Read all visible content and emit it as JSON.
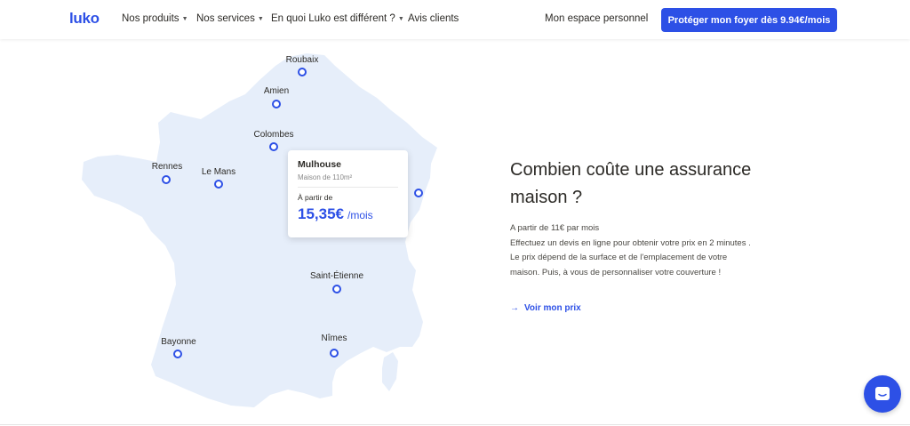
{
  "navbar": {
    "logo": "luko",
    "items": [
      {
        "label": "Nos produits",
        "dropdown": true
      },
      {
        "label": "Nos services",
        "dropdown": true
      },
      {
        "label": "En quoi Luko est différent ?",
        "dropdown": true
      },
      {
        "label": "Avis clients",
        "dropdown": false
      }
    ],
    "espace": "Mon espace personnel",
    "cta": "Protéger mon foyer dès 9.94€/mois",
    "caret": "▼"
  },
  "map": {
    "cities": [
      "Roubaix",
      "Amien",
      "Colombes",
      "Rennes",
      "Le Mans",
      "Saint-Étienne",
      "Bayonne",
      "Nîmes"
    ],
    "tooltip": {
      "city": "Mulhouse",
      "subtitle": "Maison de 110m²",
      "from": "À partir de",
      "amount": "15,35€",
      "unit": "/mois"
    }
  },
  "content": {
    "heading_line1": "Combien coûte une assurance",
    "heading_line2": "maison ?",
    "desc": [
      "A partir de 11€ par mois",
      "Effectuez un devis en ligne pour obtenir votre prix en 2 minutes .",
      "Le prix dépend de la surface et de l'emplacement de votre",
      "maison. Puis, à vous de personnaliser votre couverture !"
    ],
    "link": "Voir mon prix",
    "link_arrow": "→"
  },
  "colors": {
    "accent": "#2d50e6",
    "map_fill": "#e6eefa",
    "text": "#2c2a26"
  },
  "icons": {
    "chat": "chat-icon",
    "arrow": "arrow-right-icon",
    "caret": "caret-down-icon"
  }
}
